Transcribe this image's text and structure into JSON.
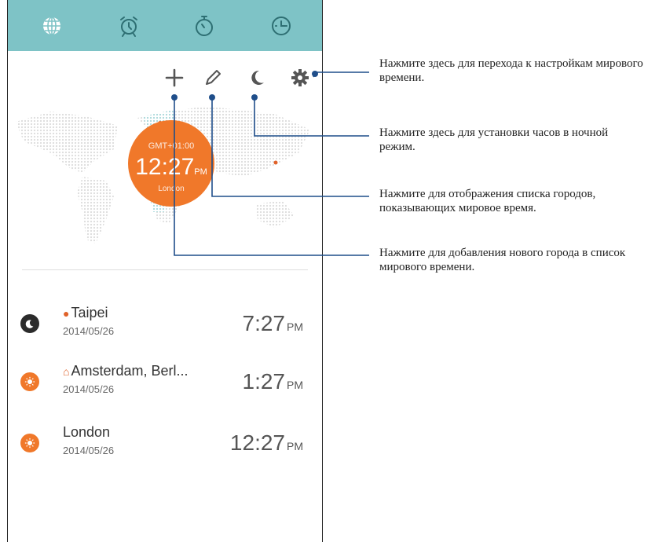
{
  "tabs": [
    {
      "icon": "world-clock-icon",
      "active": true
    },
    {
      "icon": "alarm-icon"
    },
    {
      "icon": "stopwatch-icon"
    },
    {
      "icon": "timer-icon"
    }
  ],
  "toolbar": {
    "add": "add-icon",
    "edit": "edit-pencil-icon",
    "night": "night-mode-moon-icon",
    "settings": "settings-gear-icon"
  },
  "map_badge": {
    "timezone": "GMT+01:00",
    "time": "12:27",
    "ampm": "PM",
    "city": "London"
  },
  "cities": [
    {
      "name": "Taipei",
      "marker": "location",
      "date": "2014/05/26",
      "time": "7:27",
      "ampm": "PM",
      "state": "night"
    },
    {
      "name": "Amsterdam, Berl...",
      "marker": "home",
      "date": "2014/05/26",
      "time": "1:27",
      "ampm": "PM",
      "state": "day"
    },
    {
      "name": "London",
      "marker": "none",
      "date": "2014/05/26",
      "time": "12:27",
      "ampm": "PM",
      "state": "day"
    }
  ],
  "callouts": {
    "settings": "Нажмите здесь для перехода к настройкам мирового времени.",
    "night": "Нажмите здесь для установки часов в ночной режим.",
    "edit": "Нажмите для отображения списка городов, показывающих мировое время.",
    "add": "Нажмите для добавления нового города в список мирового времени."
  },
  "colors": {
    "tabbar": "#7ec3c6",
    "accent": "#f0782a",
    "callout_line": "#1f4e8a"
  }
}
